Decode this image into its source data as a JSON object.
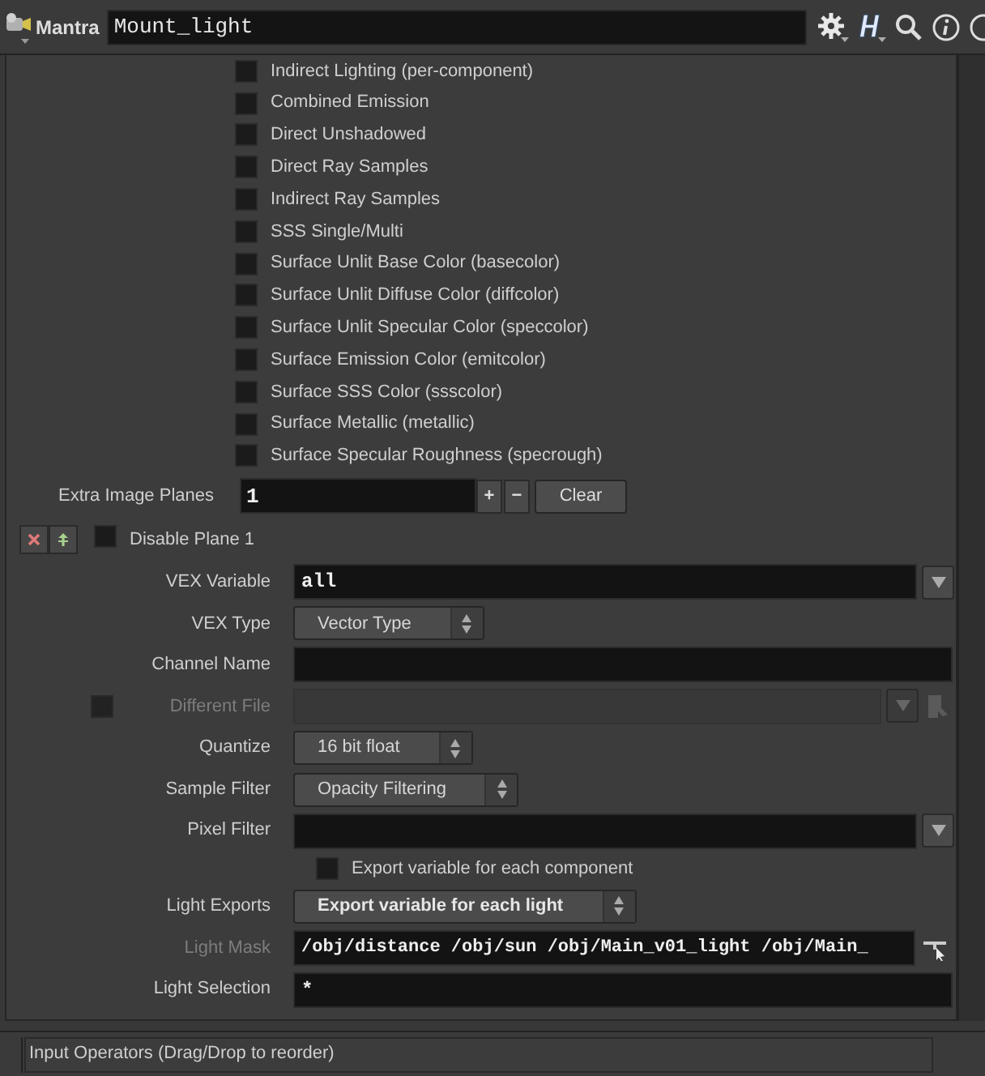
{
  "header": {
    "node_type": "Mantra",
    "node_name": "Mount_light"
  },
  "planes": [
    {
      "label": "Indirect Lighting (per-component)",
      "checked": false
    },
    {
      "label": "Combined Emission",
      "checked": false
    },
    {
      "label": "Direct Unshadowed",
      "checked": false
    },
    {
      "label": "Direct Ray Samples",
      "checked": false
    },
    {
      "label": "Indirect Ray Samples",
      "checked": false
    },
    {
      "label": "SSS Single/Multi",
      "checked": false
    },
    {
      "label": "Surface Unlit Base Color (basecolor)",
      "checked": false
    },
    {
      "label": "Surface Unlit Diffuse Color (diffcolor)",
      "checked": false
    },
    {
      "label": "Surface Unlit Specular Color (speccolor)",
      "checked": false
    },
    {
      "label": "Surface Emission Color (emitcolor)",
      "checked": false
    },
    {
      "label": "Surface SSS Color (ssscolor)",
      "checked": false
    },
    {
      "label": "Surface Metallic (metallic)",
      "checked": false
    },
    {
      "label": "Surface Specular Roughness (specrough)",
      "checked": false
    }
  ],
  "extra_image_planes": {
    "label": "Extra Image Planes",
    "value": "1",
    "add": "+",
    "remove": "−",
    "clear": "Clear"
  },
  "plane": {
    "disable_label": "Disable Plane 1",
    "disabled": false,
    "params": [
      {
        "kind": "field",
        "label": "VEX Variable",
        "value": "all",
        "dropdown": true
      },
      {
        "kind": "menu",
        "label": "VEX Type",
        "value": "Vector Type",
        "emphasized": false
      },
      {
        "kind": "field",
        "label": "Channel Name",
        "dropdown": false
      },
      {
        "kind": "file",
        "label": "Different File",
        "checked": false,
        "disabled": true
      },
      {
        "kind": "menu",
        "label": "Quantize",
        "value": "16 bit float",
        "emphasized": false
      },
      {
        "kind": "menu",
        "label": "Sample Filter",
        "value": "Opacity Filtering",
        "emphasized": false
      },
      {
        "kind": "field",
        "label": "Pixel Filter",
        "dropdown": true
      },
      {
        "kind": "toggle",
        "label": "Export variable for each component",
        "checked": false
      },
      {
        "kind": "menu",
        "label": "Light Exports",
        "value": "Export variable for each light",
        "emphasized": true
      },
      {
        "kind": "mask",
        "label": "Light Mask",
        "value": "/obj/distance /obj/sun /obj/Main_v01_light /obj/Main_"
      },
      {
        "kind": "field",
        "label": "Light Selection",
        "value": "*",
        "dropdown": false
      }
    ]
  },
  "status_bar": {
    "text": "Input Operators (Drag/Drop to reorder)"
  }
}
